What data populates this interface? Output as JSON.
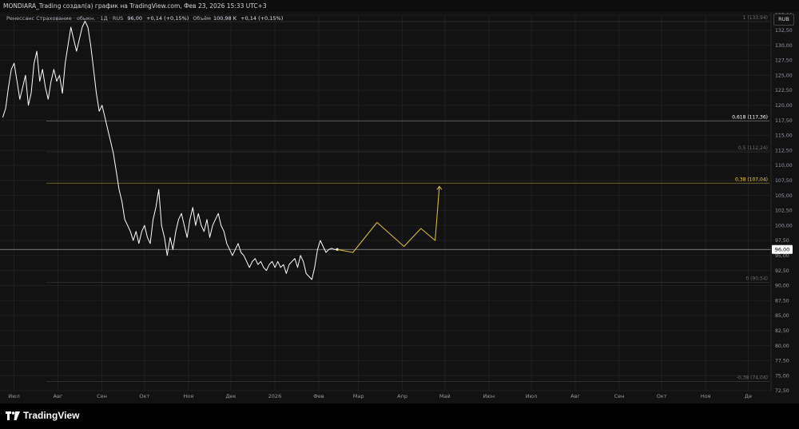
{
  "header": {
    "title": "MONDIARA_Trading создал(а) график на TradingView.com, Фев 23, 2026 15:33 UTC+3"
  },
  "legend": {
    "symbol": "Ренессанс Страхование · обыкн. · 1Д · RUS",
    "last_price": "96,00",
    "change": "+0,14 (+0,15%)",
    "volume_label": "Объём",
    "volume_value": "100,98 K",
    "volume_change": "+0,14 (+0,15%)"
  },
  "currency": "RUB",
  "price_badge": "96,00",
  "brand": {
    "name": "TradingView"
  },
  "colors": {
    "background": "#121212",
    "price_line": "#ffffff",
    "projection": "#d4b935",
    "fib_highlight": "#f0d23c",
    "fib_dim": "#6c6f78"
  },
  "chart_data": {
    "type": "line",
    "ylim": [
      72.5,
      135
    ],
    "y_ticks": [
      "72,50",
      "75,00",
      "77,50",
      "80,00",
      "82,50",
      "85,00",
      "87,50",
      "90,00",
      "92,50",
      "95,00",
      "97,50",
      "100,00",
      "102,50",
      "105,00",
      "107,50",
      "110,00",
      "112,50",
      "115,00",
      "117,50",
      "120,00",
      "122,50",
      "125,00",
      "127,50",
      "130,00",
      "132,50",
      "135,00"
    ],
    "x_ticks": [
      "Июл",
      "Авг",
      "Сен",
      "Окт",
      "Ноя",
      "Дек",
      "2026",
      "Фев",
      "Мар",
      "Апр",
      "Май",
      "Июн",
      "Июл",
      "Авг",
      "Сен",
      "Окт",
      "Ноя",
      "Де"
    ],
    "series": [
      {
        "x": [
          "2025-07-01",
          "2025-07-03",
          "2025-07-05",
          "2025-07-07",
          "2025-07-09",
          "2025-07-11",
          "2025-07-13",
          "2025-07-15",
          "2025-07-17",
          "2025-07-19",
          "2025-07-21",
          "2025-07-23",
          "2025-07-25",
          "2025-07-27",
          "2025-07-29",
          "2025-07-31",
          "2025-08-02",
          "2025-08-04",
          "2025-08-06",
          "2025-08-08",
          "2025-08-10",
          "2025-08-12",
          "2025-08-14",
          "2025-08-16",
          "2025-08-18",
          "2025-08-20",
          "2025-08-22",
          "2025-08-24",
          "2025-08-26",
          "2025-08-28",
          "2025-08-30",
          "2025-09-01",
          "2025-09-03",
          "2025-09-05",
          "2025-09-07",
          "2025-09-09",
          "2025-09-11",
          "2025-09-13",
          "2025-09-15",
          "2025-09-17",
          "2025-09-19",
          "2025-09-21",
          "2025-09-23",
          "2025-09-25",
          "2025-09-27",
          "2025-09-29",
          "2025-10-01",
          "2025-10-03",
          "2025-10-05",
          "2025-10-07",
          "2025-10-09",
          "2025-10-11",
          "2025-10-13",
          "2025-10-15",
          "2025-10-17",
          "2025-10-19",
          "2025-10-21",
          "2025-10-23",
          "2025-10-25",
          "2025-10-27",
          "2025-10-29",
          "2025-10-31",
          "2025-11-02",
          "2025-11-04",
          "2025-11-06",
          "2025-11-08",
          "2025-11-10",
          "2025-11-12",
          "2025-11-14",
          "2025-11-16",
          "2025-11-18",
          "2025-11-20",
          "2025-11-22",
          "2025-11-24",
          "2025-11-26",
          "2025-11-28",
          "2025-11-30",
          "2025-12-02",
          "2025-12-04",
          "2025-12-06",
          "2025-12-08",
          "2025-12-10",
          "2025-12-12",
          "2025-12-14",
          "2025-12-16",
          "2025-12-18",
          "2025-12-20",
          "2025-12-22",
          "2025-12-24",
          "2025-12-26",
          "2025-12-28",
          "2025-12-30",
          "2026-01-01",
          "2026-01-03",
          "2026-01-05",
          "2026-01-07",
          "2026-01-09",
          "2026-01-11",
          "2026-01-13",
          "2026-01-15",
          "2026-01-17",
          "2026-01-19",
          "2026-01-21",
          "2026-01-23",
          "2026-01-25",
          "2026-01-27",
          "2026-01-29",
          "2026-01-31",
          "2026-02-02",
          "2026-02-04",
          "2026-02-06",
          "2026-02-08",
          "2026-02-10",
          "2026-02-12",
          "2026-02-14",
          "2026-02-16",
          "2026-02-18",
          "2026-02-20",
          "2026-02-22"
        ],
        "values": [
          118,
          119.5,
          123,
          126,
          127,
          124,
          121,
          123,
          125,
          120,
          122,
          127,
          129,
          124,
          126,
          123,
          121,
          124,
          126,
          124,
          125,
          122,
          127,
          130,
          133,
          131,
          129,
          131,
          133,
          134,
          133,
          130,
          126,
          122,
          119,
          120,
          118,
          116,
          114,
          112,
          109,
          106,
          104,
          101,
          100,
          99,
          97.5,
          99,
          97,
          99,
          100,
          98,
          97,
          101,
          103,
          106,
          100,
          98,
          95,
          98,
          96,
          99,
          101,
          102,
          100,
          98,
          101,
          103,
          100,
          102,
          100,
          99,
          101,
          98,
          100,
          101,
          102,
          100,
          99,
          97,
          96,
          95,
          96,
          97,
          95.5,
          95,
          94,
          93,
          94,
          94.5,
          93.5,
          94,
          93,
          92.5,
          93.5,
          94,
          93,
          94,
          93,
          93.5,
          92,
          93.5,
          94,
          94.5,
          93,
          95,
          94,
          92,
          91.5,
          91,
          93,
          96,
          97.5,
          96.5,
          95.5,
          96,
          96.2,
          96,
          96
        ]
      },
      {
        "name": "",
        "x": [
          "2026-02-22",
          "2026-03-05",
          "2026-03-22",
          "2026-04-10",
          "2026-04-22",
          "2026-05-02",
          "2026-05-05"
        ],
        "values": [
          96,
          95.5,
          100.5,
          96.5,
          99.5,
          97.5,
          106.5
        ]
      }
    ],
    "fib_levels": [
      {
        "label": "1 (133,94)",
        "value": 133.94
      },
      {
        "label": "0,618 (117,36)",
        "value": 117.36
      },
      {
        "label": "0,5 (112,24)",
        "value": 112.24
      },
      {
        "label": "0,38 (107,04)",
        "value": 107.04
      },
      {
        "label": "0 (90,54)",
        "value": 90.54
      },
      {
        "label": "-0,38 (74,04)",
        "value": 74.04
      }
    ],
    "grid": true,
    "current_price": 96
  }
}
